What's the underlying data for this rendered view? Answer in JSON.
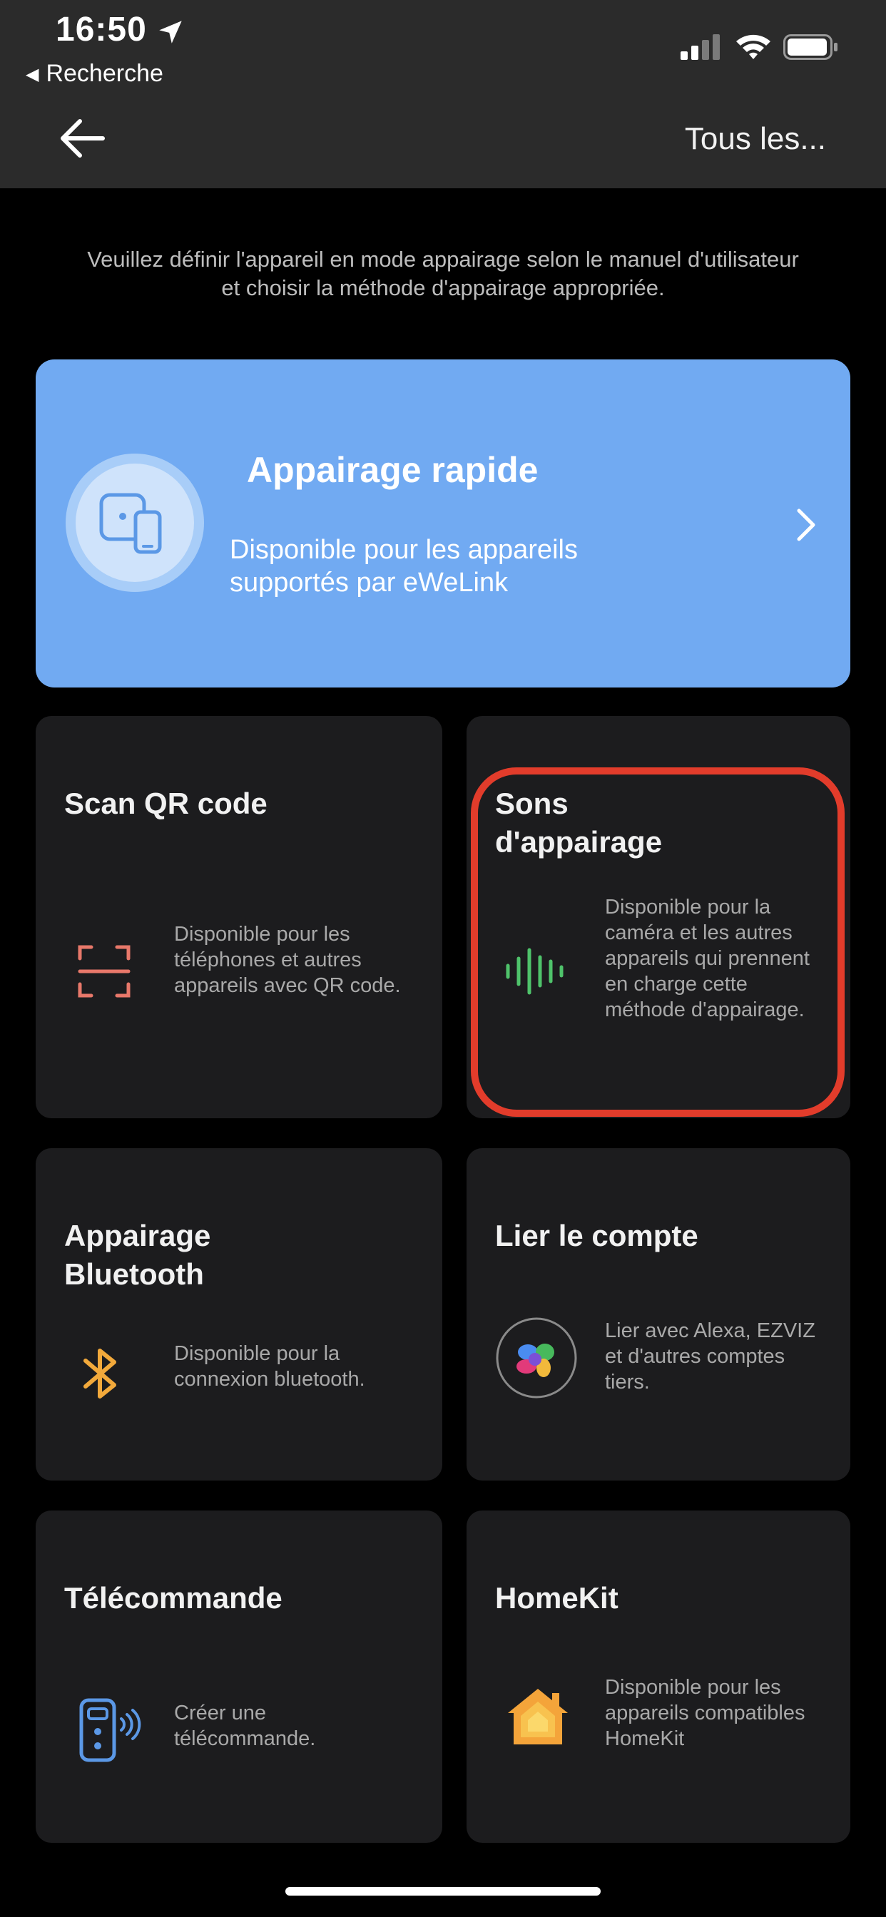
{
  "status_bar": {
    "time": "16:50",
    "back_label": "Recherche",
    "icons": [
      "location-arrow-icon",
      "cellular-signal-icon",
      "wifi-icon",
      "battery-icon"
    ]
  },
  "header": {
    "back_icon": "arrow-left-icon",
    "right_link": "Tous les..."
  },
  "instruction": "Veuillez définir l'appareil en mode appairage selon le manuel d'utilisateur et choisir la méthode d'appairage appropriée.",
  "quick_pairing": {
    "title": "Appairage rapide",
    "description": "Disponible pour les appareils supportés par eWeLink",
    "icon": "phone-device-icon",
    "chevron": "chevron-right-icon",
    "color": "#71aaf2"
  },
  "methods": [
    {
      "title": "Scan QR code",
      "description": "Disponible pour les téléphones et autres appareils avec QR code.",
      "icon": "qr-scan-icon"
    },
    {
      "title": "Sons d'appairage",
      "description": "Disponible pour la caméra et les autres appareils qui prennent en charge cette méthode d'appairage.",
      "icon": "sound-wave-icon"
    },
    {
      "title": "Appairage Bluetooth",
      "description": "Disponible pour la connexion bluetooth.",
      "icon": "bluetooth-icon"
    },
    {
      "title": "Lier le compte",
      "description": "Lier avec Alexa, EZVIZ et d'autres comptes tiers.",
      "icon": "linked-accounts-icon"
    },
    {
      "title": "Télécommande",
      "description": "Créer une télécommande.",
      "icon": "remote-control-icon"
    },
    {
      "title": "HomeKit",
      "description": "Disponible pour les appareils compatibles HomeKit",
      "icon": "homekit-house-icon"
    }
  ],
  "highlight_color": "#e23c2b"
}
